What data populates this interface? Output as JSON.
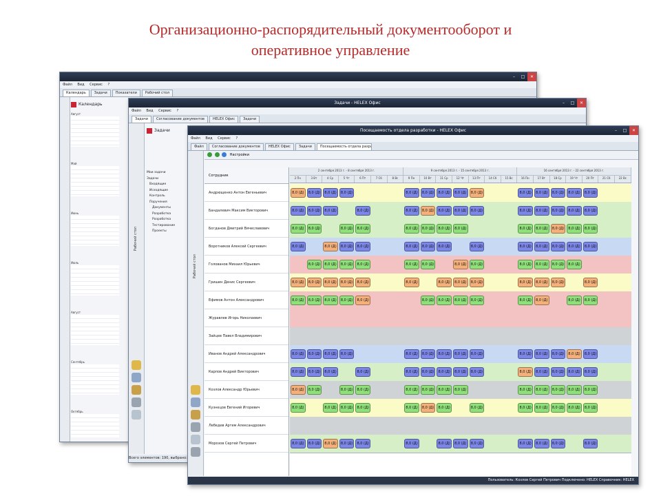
{
  "slide": {
    "title_line1": "Организационно-распорядительный документооборот и",
    "title_line2": "оперативное управление"
  },
  "window_back": {
    "menu": [
      "Файл",
      "Вид",
      "Сервис",
      "?"
    ],
    "tabs": [
      "Календарь",
      "Задачи",
      "Показатели",
      "Рабочий стол"
    ],
    "panel_title": "Календарь",
    "months": [
      "Август",
      "Май",
      "Июнь",
      "Июль",
      "Август",
      "Сентябрь",
      "Октябрь"
    ]
  },
  "window_mid": {
    "title": "Задачи - HELEX Офис",
    "menu": [
      "Файл",
      "Вид",
      "Сервис",
      "?"
    ],
    "tabs": [
      "Задачи",
      "Согласование документов",
      "HELEX Офис",
      "Задачи"
    ],
    "panel_title": "Задачи",
    "vertical_label": "Рабочий стол",
    "tree_items": [
      "Мои задачи",
      "Задачи",
      "Входящие",
      "Исходящие",
      "Контроль",
      "Поручения",
      "Документы",
      "Разработка",
      "Разработка",
      "Тестирование",
      "Проекты"
    ],
    "status": "Всего элементов: 190, выбрано: 1"
  },
  "window_front": {
    "title": "Посещаемость отдела разработки - HELEX Офис",
    "menu": [
      "Файл",
      "Вид",
      "Сервис",
      "?"
    ],
    "tabs": [
      "Файл",
      "Согласование документов",
      "HELEX Офис",
      "Задачи",
      "Посещаемость отдела разработки"
    ],
    "toolbar_label": "Настройки",
    "vertical_label": "Рабочий стол",
    "names_header": "Сотрудник",
    "weeks": [
      "2 сентября 2013 г. - 8 сентября 2013 г.",
      "9 сентября 2013 г. - 15 сентября 2013 г.",
      "16 сентября 2013 г. - 22 сентября 2013 г."
    ],
    "days": [
      "2 Пн",
      "3 Вт",
      "4 Ср",
      "5 Чт",
      "6 Пт",
      "7 Сб",
      "8 Вс",
      "9 Пн",
      "10 Вт",
      "11 Ср",
      "12 Чт",
      "13 Пт",
      "14 Сб",
      "15 Вс",
      "16 Пн",
      "17 Вт",
      "18 Ср",
      "19 Чт",
      "20 Пт",
      "21 Сб",
      "22 Вс"
    ],
    "employees": [
      "Андрющенко Антон Евгеньевич",
      "Бандалевич Максим Викторович",
      "Богданов Дмитрий Вячеславович",
      "Воротников Алексей Сергеевич",
      "Голованов Михаил Юрьевич",
      "Гришин Денис Сергеевич",
      "Ефимов Антон Александрович",
      "Журавлев Игорь Николаевич",
      "Зайцев Павел Владимирович",
      "Иванов Андрей Александрович",
      "Карпов Андрей Викторович",
      "Козлов Александр Юрьевич",
      "Кузнецов Евгений Игоревич",
      "Лебедев Артем Александрович",
      "Морозов Сергей Петрович"
    ],
    "cell_label": "8,0 (Д)",
    "status": "Пользователь: Козлов Сергей Петрович   Подключено: HELEX   Справочник: HELEX",
    "colors": {
      "blue": "#7b86e6",
      "green": "#8fe07a",
      "orange": "#f3b07a",
      "yellow": "#fbfbc8",
      "pink": "#f3c3c3",
      "lightgreen": "#d6efc6",
      "lightblue": "#c8d9f3",
      "grey": "#cfd3d6"
    }
  }
}
